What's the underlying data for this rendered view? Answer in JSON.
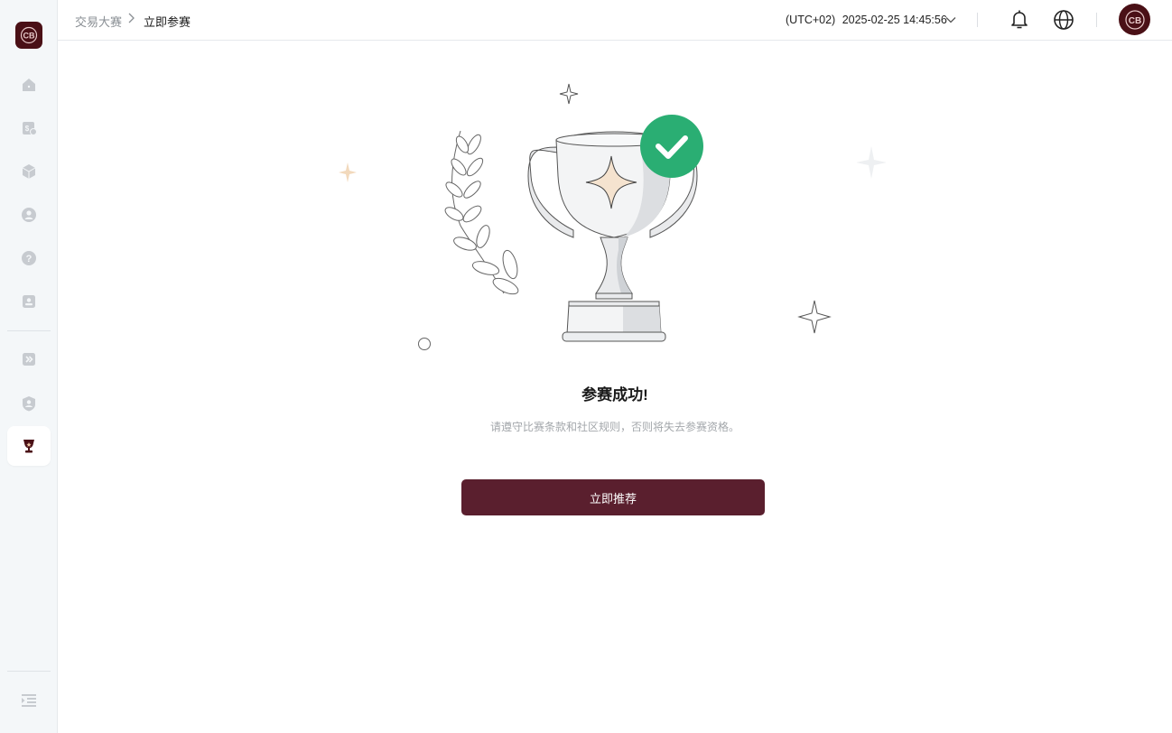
{
  "sidebar": {
    "items": [
      {
        "icon": "home-icon"
      },
      {
        "icon": "dollar-card-icon"
      },
      {
        "icon": "cube-icon"
      },
      {
        "icon": "user-icon"
      },
      {
        "icon": "help-icon"
      },
      {
        "icon": "id-card-icon"
      },
      {
        "icon": "forward-icon"
      },
      {
        "icon": "user-shield-icon"
      },
      {
        "icon": "trophy-icon",
        "active": true
      }
    ],
    "collapse_icon": "indent-icon"
  },
  "header": {
    "breadcrumb": [
      "交易大赛",
      "立即参赛"
    ],
    "timezone": "(UTC+02)",
    "datetime": "2025-02-25 14:45:56",
    "icons": [
      "bell-icon",
      "globe-icon"
    ]
  },
  "main": {
    "title": "参赛成功!",
    "subtitle": "请遵守比赛条款和社区规则，否则将失去参赛资格。",
    "cta_label": "立即推荐"
  },
  "colors": {
    "brand": "#4a1016",
    "cta": "#5a1f2e",
    "success": "#2aae73",
    "sidebar_bg": "#f4f7f9"
  }
}
